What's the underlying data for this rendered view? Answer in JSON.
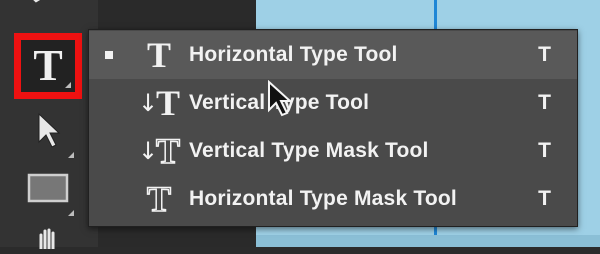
{
  "toolbar": {
    "tools": [
      {
        "name": "brush-tool",
        "icon": "brush-icon"
      },
      {
        "name": "type-tool",
        "icon": "type-icon",
        "glyph": "T",
        "highlighted": true
      },
      {
        "name": "move-tool",
        "icon": "pointer-arrow-icon"
      },
      {
        "name": "rectangle-tool",
        "icon": "rectangle-icon"
      },
      {
        "name": "hand-tool",
        "icon": "hand-icon"
      }
    ]
  },
  "flyout": {
    "items": [
      {
        "label": "Horizontal Type Tool",
        "shortcut": "T",
        "selected": true,
        "icon": "horizontal-type-icon",
        "icon_glyph": "T"
      },
      {
        "label": "Vertical Type Tool",
        "shortcut": "T",
        "selected": false,
        "icon": "vertical-type-icon",
        "icon_glyph": "T"
      },
      {
        "label": "Vertical Type Mask Tool",
        "shortcut": "T",
        "selected": false,
        "icon": "vertical-type-mask-icon",
        "icon_glyph": "T"
      },
      {
        "label": "Horizontal Type Mask Tool",
        "shortcut": "T",
        "selected": false,
        "icon": "horizontal-type-mask-icon",
        "icon_glyph": "T"
      }
    ]
  },
  "colors": {
    "highlight_border": "#ee1111",
    "canvas": "#9ed0e6",
    "guide": "#1e86d6"
  }
}
